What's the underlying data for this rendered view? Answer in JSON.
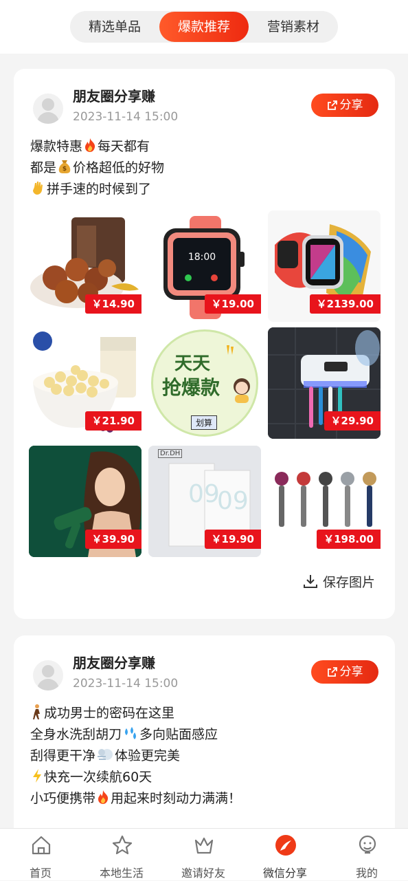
{
  "top_tabs": [
    {
      "label": "精选单品"
    },
    {
      "label": "爆款推荐"
    },
    {
      "label": "营销素材"
    }
  ],
  "top_tabs_active": "爆款推荐",
  "posts": [
    {
      "user": "朋友圈分享赚",
      "time": "2023-11-14 15:00",
      "share_label": "分享",
      "lines": [
        {
          "a": "爆款特惠",
          "icon": "fire-emoji",
          "b": "每天都有"
        },
        {
          "a": "都是",
          "icon": "money-bag-emoji",
          "b": "价格超低的好物"
        },
        {
          "a": "",
          "icon": "waving-hand-emoji",
          "b": "拼手速的时候到了"
        }
      ],
      "products": [
        {
          "name": "chocolate-truffles",
          "price": "￥14.90"
        },
        {
          "name": "kids-smartwatch",
          "price": "￥19.00"
        },
        {
          "name": "apple-watch",
          "price": "￥2139.00"
        },
        {
          "name": "yogurt-melts",
          "price": "￥21.90"
        },
        {
          "name": "daily-deals-banner",
          "banner_line1": "天天",
          "banner_line2": "抢爆款",
          "banner_tag": "划算"
        },
        {
          "name": "toothbrush-holder",
          "price": "￥29.90"
        },
        {
          "name": "hair-dryer-model",
          "price": "￥39.90"
        },
        {
          "name": "facial-mask-box",
          "brand": "Dr.DH",
          "price": "￥19.90"
        },
        {
          "name": "hair-dryers-set",
          "price": "￥198.00"
        }
      ],
      "save_label": "保存图片"
    },
    {
      "user": "朋友圈分享赚",
      "time": "2023-11-14 15:00",
      "share_label": "分享",
      "lines": [
        {
          "a": "",
          "icon": "walking-man-emoji",
          "b": "成功男士的密码在这里"
        },
        {
          "a": "全身水洗刮胡刀",
          "icon": "droplets-emoji",
          "b": "多向贴面感应"
        },
        {
          "a": "刮得更干净",
          "icon": "dash-emoji",
          "b": "体验更完美"
        },
        {
          "a": "",
          "icon": "lightning-emoji",
          "b": "快充一次续航60天"
        },
        {
          "a": "小巧便携带",
          "icon": "fire-emoji",
          "b": "用起来时刻动力满满！"
        }
      ]
    }
  ],
  "bottom_tabs": [
    {
      "label": "首页",
      "icon": "home-icon"
    },
    {
      "label": "本地生活",
      "icon": "star-icon"
    },
    {
      "label": "邀请好友",
      "icon": "crown-icon"
    },
    {
      "label": "微信分享",
      "icon": "share-feather-icon"
    },
    {
      "label": "我的",
      "icon": "person-icon"
    }
  ],
  "bottom_tabs_active": "微信分享",
  "colors": {
    "accent": "#ef3a17",
    "price_tag": "#e8141c",
    "bg": "#f4f4f4"
  }
}
